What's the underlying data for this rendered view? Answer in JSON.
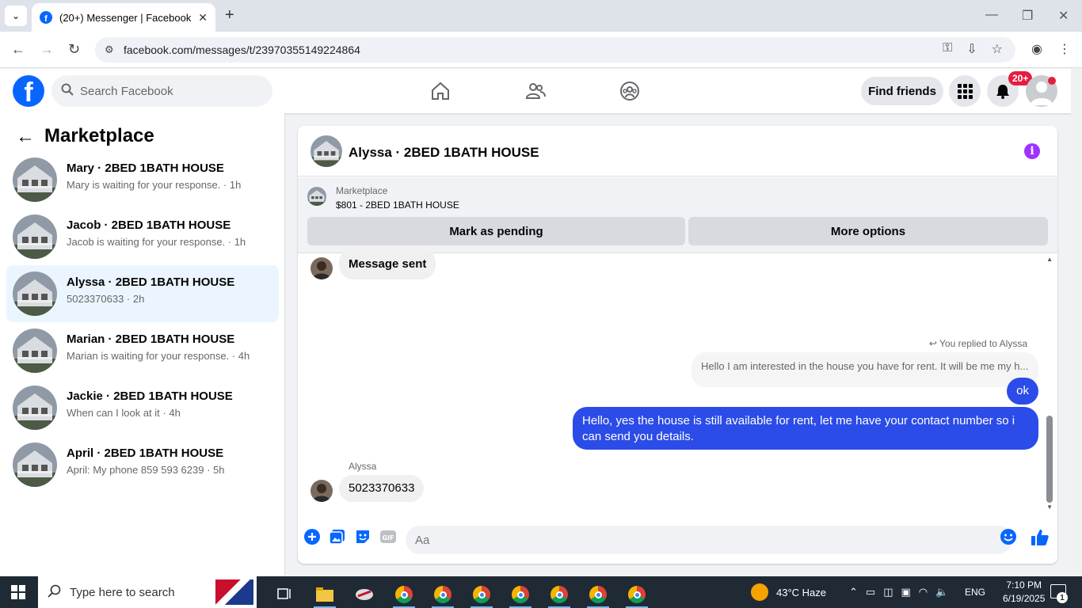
{
  "browser": {
    "tab_title": "(20+) Messenger | Facebook",
    "url": "facebook.com/messages/t/23970355149224864"
  },
  "header": {
    "search_placeholder": "Search Facebook",
    "find_friends": "Find friends",
    "notifications_badge": "20+"
  },
  "sidebar": {
    "title": "Marketplace",
    "conversations": [
      {
        "name": "Mary · 2BED 1BATH HOUSE",
        "sub": "Mary is waiting for your response. · 1h",
        "active": false
      },
      {
        "name": "Jacob · 2BED 1BATH HOUSE",
        "sub": "Jacob is waiting for your response. · 1h",
        "active": false
      },
      {
        "name": "Alyssa · 2BED 1BATH HOUSE",
        "sub": "5023370633 · 2h",
        "active": true
      },
      {
        "name": "Marian · 2BED 1BATH HOUSE",
        "sub": "Marian is waiting for your response. · 4h",
        "active": false
      },
      {
        "name": "Jackie · 2BED 1BATH HOUSE",
        "sub": "When can I look at it · 4h",
        "active": false
      },
      {
        "name": "April · 2BED 1BATH HOUSE",
        "sub": "April: My phone 859 593 6239 · 5h",
        "active": false
      }
    ]
  },
  "chat": {
    "title": "Alyssa · 2BED 1BATH HOUSE",
    "marketplace_label": "Marketplace",
    "listing": "$801 - 2BED 1BATH HOUSE",
    "mark_pending": "Mark as pending",
    "more_options": "More options",
    "messages": {
      "sent_note": "Message sent",
      "replied_to": "You replied to Alyssa",
      "quoted": "Hello I am interested in the house you have for rent. It will be me my h...",
      "ok": "ok",
      "reply": "Hello, yes the house is still available for rent, let me have your contact number so i can send you details.",
      "sender_name": "Alyssa",
      "phone": "5023370633"
    },
    "composer_placeholder": "Aa"
  },
  "taskbar": {
    "search_placeholder": "Type here to search",
    "weather": "43°C  Haze",
    "lang": "ENG",
    "time": "7:10 PM",
    "date": "6/19/2025",
    "notif_count": "1"
  },
  "colors": {
    "fb_blue": "#0866ff",
    "bubble_blue": "#2b4ce8",
    "active_row": "#ebf5ff",
    "badge_red": "#e41e3f",
    "info_purple": "#a033ff"
  }
}
